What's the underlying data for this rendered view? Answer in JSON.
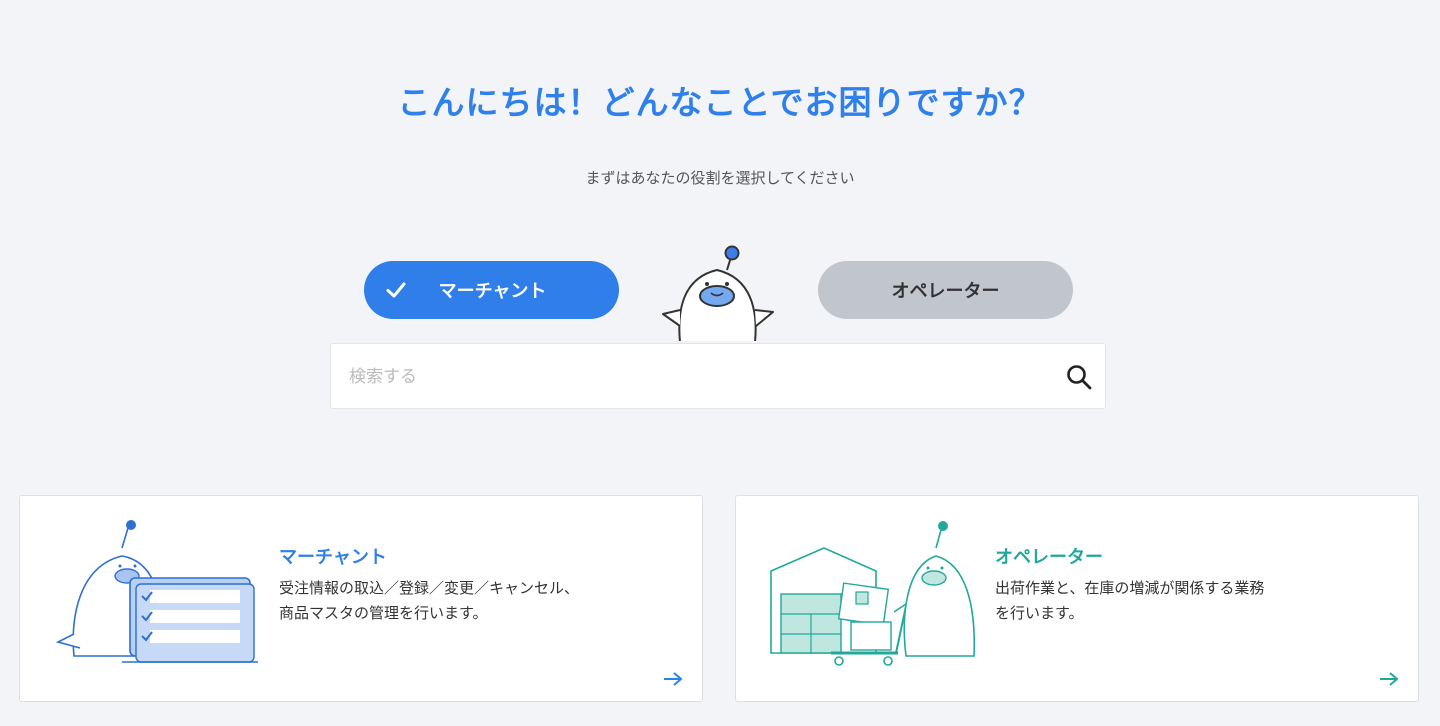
{
  "header": {
    "title": "こんにちは！どんなことでお困りですか？",
    "subtitle": "まずはあなたの役割を選択してください"
  },
  "roles": {
    "merchant_label": "マーチャント",
    "operator_label": "オペレーター",
    "selected": "merchant"
  },
  "search": {
    "placeholder": "検索する",
    "value": ""
  },
  "cards": [
    {
      "title": "マーチャント",
      "description": "受注情報の取込／登録／変更／キャンセル、\n商品マスタの管理を行います。"
    },
    {
      "title": "オペレーター",
      "description": "出荷作業と、在庫の増減が関係する業務\nを行います。"
    }
  ],
  "colors": {
    "accent": "#2f80ea",
    "operator": "#22a89a",
    "inactive": "#c1c6cd",
    "background": "#f3f4f7"
  }
}
